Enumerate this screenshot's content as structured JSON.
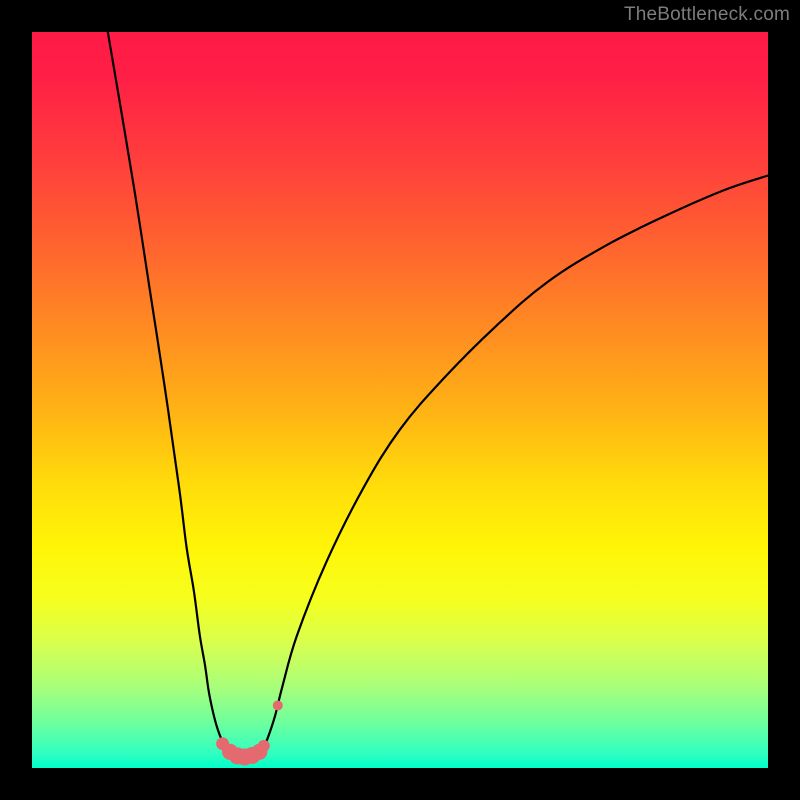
{
  "watermark": {
    "text": "TheBottleneck.com"
  },
  "chart_data": {
    "type": "line",
    "title": "",
    "xlabel": "",
    "ylabel": "",
    "xlim": [
      0,
      100
    ],
    "ylim": [
      0,
      100
    ],
    "grid": false,
    "legend": false,
    "background": "rainbow-gradient-vertical",
    "series": [
      {
        "name": "left-curve",
        "x": [
          10.3,
          12,
          14,
          16,
          18,
          20,
          21,
          22,
          22.8,
          23.5,
          24,
          24.5,
          25,
          25.5,
          26,
          26.5,
          27,
          27.5
        ],
        "y": [
          100,
          90,
          78,
          65,
          52,
          38,
          30,
          24,
          18,
          14,
          10.5,
          8,
          6,
          4.5,
          3.4,
          2.6,
          2.1,
          1.8
        ]
      },
      {
        "name": "right-curve",
        "x": [
          30.5,
          31,
          31.5,
          32,
          33,
          34,
          36,
          40,
          45,
          50,
          56,
          63,
          70,
          78,
          86,
          94,
          100
        ],
        "y": [
          1.8,
          2.2,
          3,
          4,
          7,
          11,
          18,
          28,
          38,
          46,
          53,
          60,
          66,
          71,
          75,
          78.5,
          80.5
        ]
      },
      {
        "name": "trough-floor",
        "x": [
          27.5,
          28,
          28.7,
          29.4,
          30.1,
          30.5
        ],
        "y": [
          1.8,
          1.55,
          1.45,
          1.45,
          1.6,
          1.8
        ]
      }
    ],
    "markers": [
      {
        "name": "trough-dot",
        "x": 25.9,
        "y": 3.3,
        "r": 6.5,
        "color": "#e46a6f"
      },
      {
        "name": "trough-dot",
        "x": 26.9,
        "y": 2.2,
        "r": 8,
        "color": "#e46a6f"
      },
      {
        "name": "trough-dot",
        "x": 27.9,
        "y": 1.65,
        "r": 8.5,
        "color": "#e46a6f"
      },
      {
        "name": "trough-dot",
        "x": 28.9,
        "y": 1.5,
        "r": 8.5,
        "color": "#e46a6f"
      },
      {
        "name": "trough-dot",
        "x": 29.9,
        "y": 1.7,
        "r": 8.5,
        "color": "#e46a6f"
      },
      {
        "name": "trough-dot",
        "x": 30.9,
        "y": 2.2,
        "r": 8,
        "color": "#e46a6f"
      },
      {
        "name": "trough-dot",
        "x": 31.5,
        "y": 3.0,
        "r": 6,
        "color": "#e46a6f"
      },
      {
        "name": "trough-dot",
        "x": 33.4,
        "y": 8.5,
        "r": 5,
        "color": "#e46a6f"
      }
    ]
  }
}
